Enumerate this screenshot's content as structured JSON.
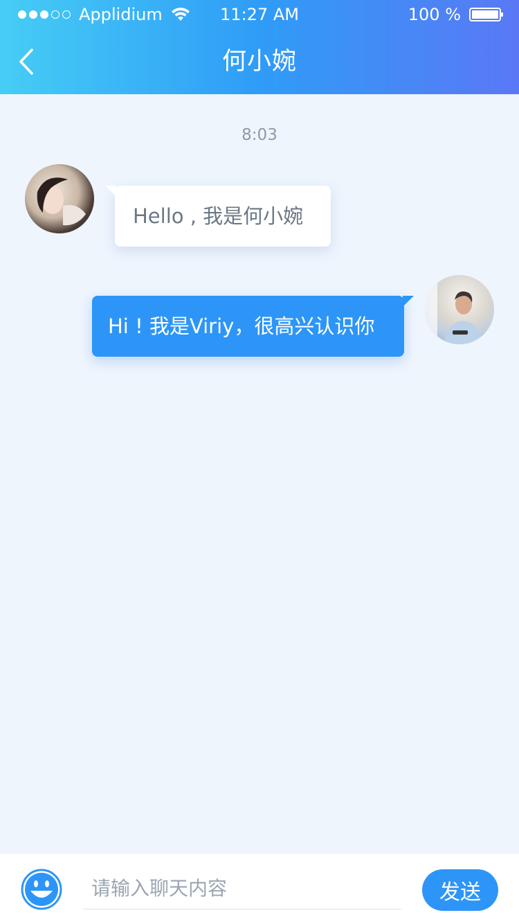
{
  "status_bar": {
    "carrier": "Applidium",
    "time": "11:27 AM",
    "battery": "100 %",
    "signal_bars_filled": 3,
    "signal_bars_total": 5
  },
  "header": {
    "title": "何小婉",
    "back_icon": "chevron-left-icon"
  },
  "chat": {
    "timestamp": "8:03",
    "messages": [
      {
        "side": "left",
        "text": "Hello , 我是何小婉"
      },
      {
        "side": "right",
        "text": "Hi ! 我是Viriy，很高兴认识你"
      }
    ]
  },
  "input_bar": {
    "placeholder": "请输入聊天内容",
    "send_label": "发送",
    "emoji_icon": "smiley-icon"
  },
  "colors": {
    "header_gradient_start": "#46cdf5",
    "header_gradient_end": "#5a78f6",
    "accent": "#2d95f7",
    "background": "#eef5fd"
  }
}
